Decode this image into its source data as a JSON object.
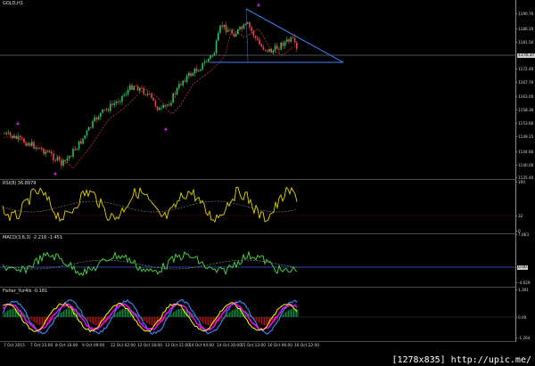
{
  "main": {
    "label": "GOLD,H1",
    "price_ticks": [
      "1190.70",
      "1186.20",
      "1181.50",
      "1176.37",
      "1172.40",
      "1167.70",
      "1163.00",
      "1158.30",
      "1153.60",
      "1149.15",
      "1144.60",
      "1140.00",
      "1135.40"
    ],
    "current_price": "1176.37",
    "trendline_color": "#3b82f6",
    "bull_color": "#22c55e",
    "bear_color": "#ef4444",
    "ma_color": "#c0392b",
    "arrow_color": "#c026d3"
  },
  "rsi": {
    "label": "RSI(8) 36.8979",
    "ticks": [
      "100",
      "32",
      "0"
    ],
    "line_color": "#e5d400"
  },
  "macd": {
    "label": "MACD(3,6,3) -2.216 -1.451",
    "ticks": [
      "7.063",
      "0.00",
      "-4.629"
    ],
    "line_color": "#4ade40"
  },
  "fisher": {
    "label": "Fisher_Yur4ik -0.181",
    "ticks": [
      "1.361",
      "0.00",
      "-1.264"
    ],
    "colors": [
      "#ffff00",
      "#ff00ff",
      "#22c55e",
      "#3b82f6"
    ]
  },
  "xaxis": {
    "labels": [
      "7 Oct 2015",
      "7 Oct 23:00",
      "8 Oct 16:00",
      "9 Oct 09:00",
      "12 Oct 02:00",
      "12 Oct 18:00",
      "13 Oct 11:00",
      "14 Oct 04:00",
      "14 Oct 20:00",
      "15 Oct 13:00",
      "16 Oct 06:00",
      "16 Oct 22:00"
    ]
  },
  "watermark": "[1278x835] http://upic.me/"
}
